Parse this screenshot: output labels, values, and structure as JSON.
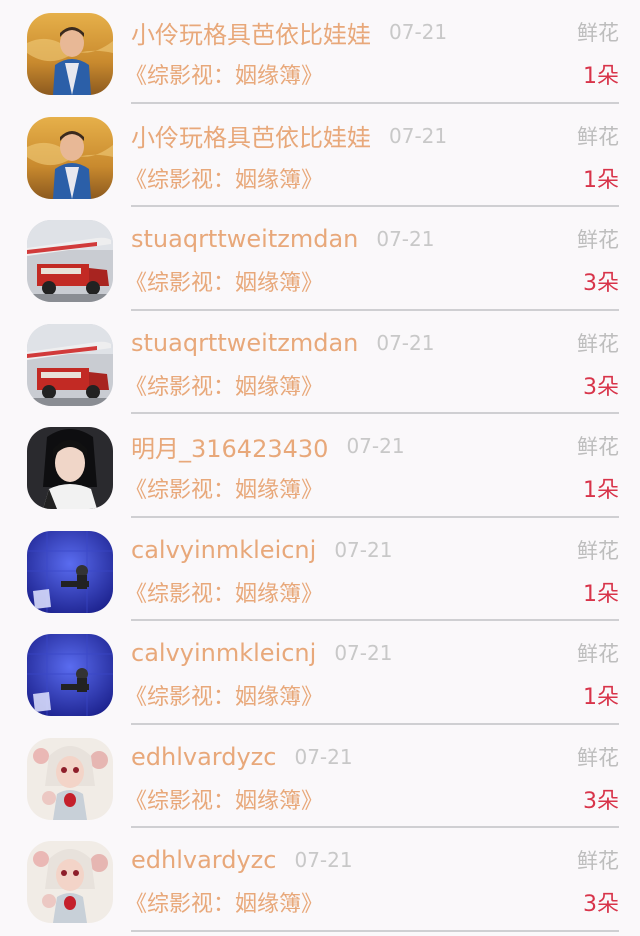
{
  "rows": [
    {
      "name": "小伶玩格具芭依比娃娃",
      "date": "07-21",
      "gift": "鲜花",
      "book": "《综影视：姻缘簿》",
      "count": "1朵",
      "avatar": "boy-in-field"
    },
    {
      "name": "小伶玩格具芭依比娃娃",
      "date": "07-21",
      "gift": "鲜花",
      "book": "《综影视：姻缘簿》",
      "count": "1朵",
      "avatar": "boy-in-field"
    },
    {
      "name": "stuaqrttweitzmdan",
      "date": "07-21",
      "gift": "鲜花",
      "book": "《综影视：姻缘簿》",
      "count": "3朵",
      "avatar": "airplane-fire-truck"
    },
    {
      "name": "stuaqrttweitzmdan",
      "date": "07-21",
      "gift": "鲜花",
      "book": "《综影视：姻缘簿》",
      "count": "3朵",
      "avatar": "airplane-fire-truck"
    },
    {
      "name": "明月_316423430",
      "date": "07-21",
      "gift": "鲜花",
      "book": "《综影视：姻缘簿》",
      "count": "1朵",
      "avatar": "girl-portrait"
    },
    {
      "name": "calvyinmkleicnj",
      "date": "07-21",
      "gift": "鲜花",
      "book": "《综影视：姻缘簿》",
      "count": "1朵",
      "avatar": "blue-room"
    },
    {
      "name": "calvyinmkleicnj",
      "date": "07-21",
      "gift": "鲜花",
      "book": "《综影视：姻缘簿》",
      "count": "1朵",
      "avatar": "blue-room"
    },
    {
      "name": "edhlvardyzc",
      "date": "07-21",
      "gift": "鲜花",
      "book": "《综影视：姻缘簿》",
      "count": "3朵",
      "avatar": "doll-illustration"
    },
    {
      "name": "edhlvardyzc",
      "date": "07-21",
      "gift": "鲜花",
      "book": "《综影视：姻缘簿》",
      "count": "3朵",
      "avatar": "doll-illustration"
    }
  ],
  "colors": {
    "name": "#e8a87a",
    "date": "#c8c8c8",
    "gift": "#bdbdbd",
    "count": "#d8344a",
    "divider": "#cfcfd2",
    "background": "#faf8fa"
  }
}
